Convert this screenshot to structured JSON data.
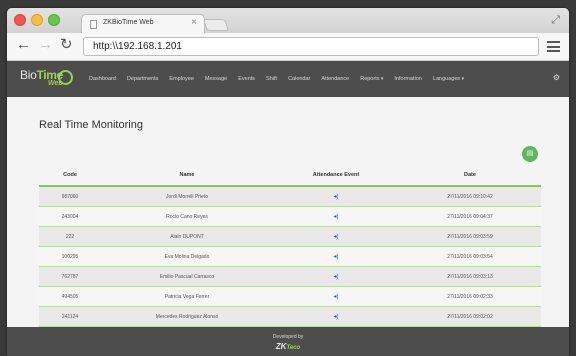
{
  "browser": {
    "tab_title": "ZKBioTime Web",
    "tab_close": "×",
    "url": "http:\\\\192.168.1.201",
    "icons": {
      "back": "arrow-left",
      "forward": "arrow-right",
      "reload": "reload",
      "menu": "hamburger",
      "restore": "expand-arrows"
    }
  },
  "app": {
    "logo": {
      "bio": "Bio",
      "time": "Time",
      "web": "Web"
    },
    "nav": [
      {
        "label": "Dashboard"
      },
      {
        "label": "Departments"
      },
      {
        "label": "Employee"
      },
      {
        "label": "Message"
      },
      {
        "label": "Events"
      },
      {
        "label": "Shift"
      },
      {
        "label": "Calendar"
      },
      {
        "label": "Attendance"
      },
      {
        "label": "Reports"
      },
      {
        "label": "Information"
      },
      {
        "label": "Languages"
      }
    ],
    "accent_color": "#8dc25a",
    "nav_bg": "#4d4d4d"
  },
  "page": {
    "title": "Real Time Monitoring",
    "export_icon": "document-icon"
  },
  "table": {
    "headers": [
      "Code",
      "Name",
      "Attendance Event",
      "Date"
    ],
    "event_icon": "speaker-icon",
    "rows": [
      {
        "code": "987060",
        "name": "Jordi Morrell Prieto",
        "event": "◂)",
        "date": "27/11/2016 09:10:42"
      },
      {
        "code": "243004",
        "name": "Rocio Cano Reyes",
        "event": "◂)",
        "date": "27/11/2016 09:04:37"
      },
      {
        "code": "222",
        "name": "Alain DUPONT",
        "event": "◂)",
        "date": "27/11/2016 09:03:59"
      },
      {
        "code": "100295",
        "name": "Eva Molina Delgado",
        "event": "◂)",
        "date": "27/11/2016 09:03:54"
      },
      {
        "code": "762787",
        "name": "Emilio Pascual Carrasco",
        "event": "◂)",
        "date": "27/11/2016 09:03:13"
      },
      {
        "code": "494505",
        "name": "Patricia Vega Ferrer",
        "event": "◂)",
        "date": "27/11/2016 09:02:33"
      },
      {
        "code": "241124",
        "name": "Mercedes Rodriguez Alonso",
        "event": "◂)",
        "date": "27/11/2016 09:02:02"
      }
    ]
  },
  "footer": {
    "developed_by": "Developed by",
    "brand": "ZK",
    "brand_suffix": "Teco"
  }
}
